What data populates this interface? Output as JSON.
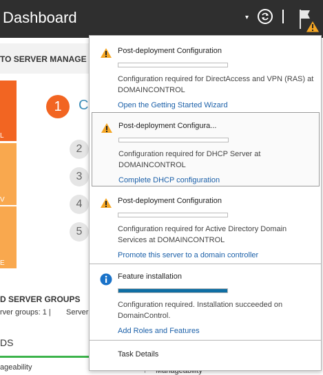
{
  "header": {
    "title": "Dashboard",
    "caret": "▾",
    "refresh_icon": "refresh-icon",
    "flag_icon": "flag-warning-icon"
  },
  "background": {
    "welcome_bar": "TO SERVER MANAGE",
    "tile_chars": [
      "L",
      "V",
      "E"
    ],
    "step_active": "1",
    "step_active_text": "C",
    "steps": [
      "2",
      "3",
      "4",
      "5"
    ],
    "groups_title": "D SERVER GROUPS",
    "groups_sub": "rver groups: 1   |",
    "groups_sub2": "Server",
    "ds_label": "DS",
    "manage_label": "ageability",
    "manage_label2": "Manageability"
  },
  "notifications": [
    {
      "icon": "warning-icon",
      "title": "Post-deployment Configuration",
      "progress": 0,
      "description": "Configuration required for DirectAccess and VPN (RAS) at DOMAINCONTROL",
      "link": "Open the Getting Started Wizard",
      "selected": false
    },
    {
      "icon": "warning-icon",
      "title": "Post-deployment Configura...",
      "progress": 0,
      "description": "Configuration required for DHCP Server at DOMAINCONTROL",
      "link": "Complete DHCP configuration",
      "selected": true
    },
    {
      "icon": "warning-icon",
      "title": "Post-deployment Configuration",
      "progress": 0,
      "description": "Configuration required for Active Directory Domain Services at DOMAINCONTROL",
      "link": "Promote this server to a domain controller",
      "selected": false
    },
    {
      "icon": "info-icon",
      "title": "Feature installation",
      "progress": 1,
      "description": "Configuration required. Installation succeeded on DomainControl.",
      "link": "Add Roles and Features",
      "selected": false
    }
  ],
  "footer": {
    "task_details": "Task Details"
  },
  "colors": {
    "header_bg": "#2f2f2f",
    "warning": "#f5a623",
    "info": "#1a73c9",
    "link": "#1a5fa8",
    "progress_fill": "#0f6ea3",
    "orange": "#f26522",
    "light_orange": "#f9a84e"
  }
}
